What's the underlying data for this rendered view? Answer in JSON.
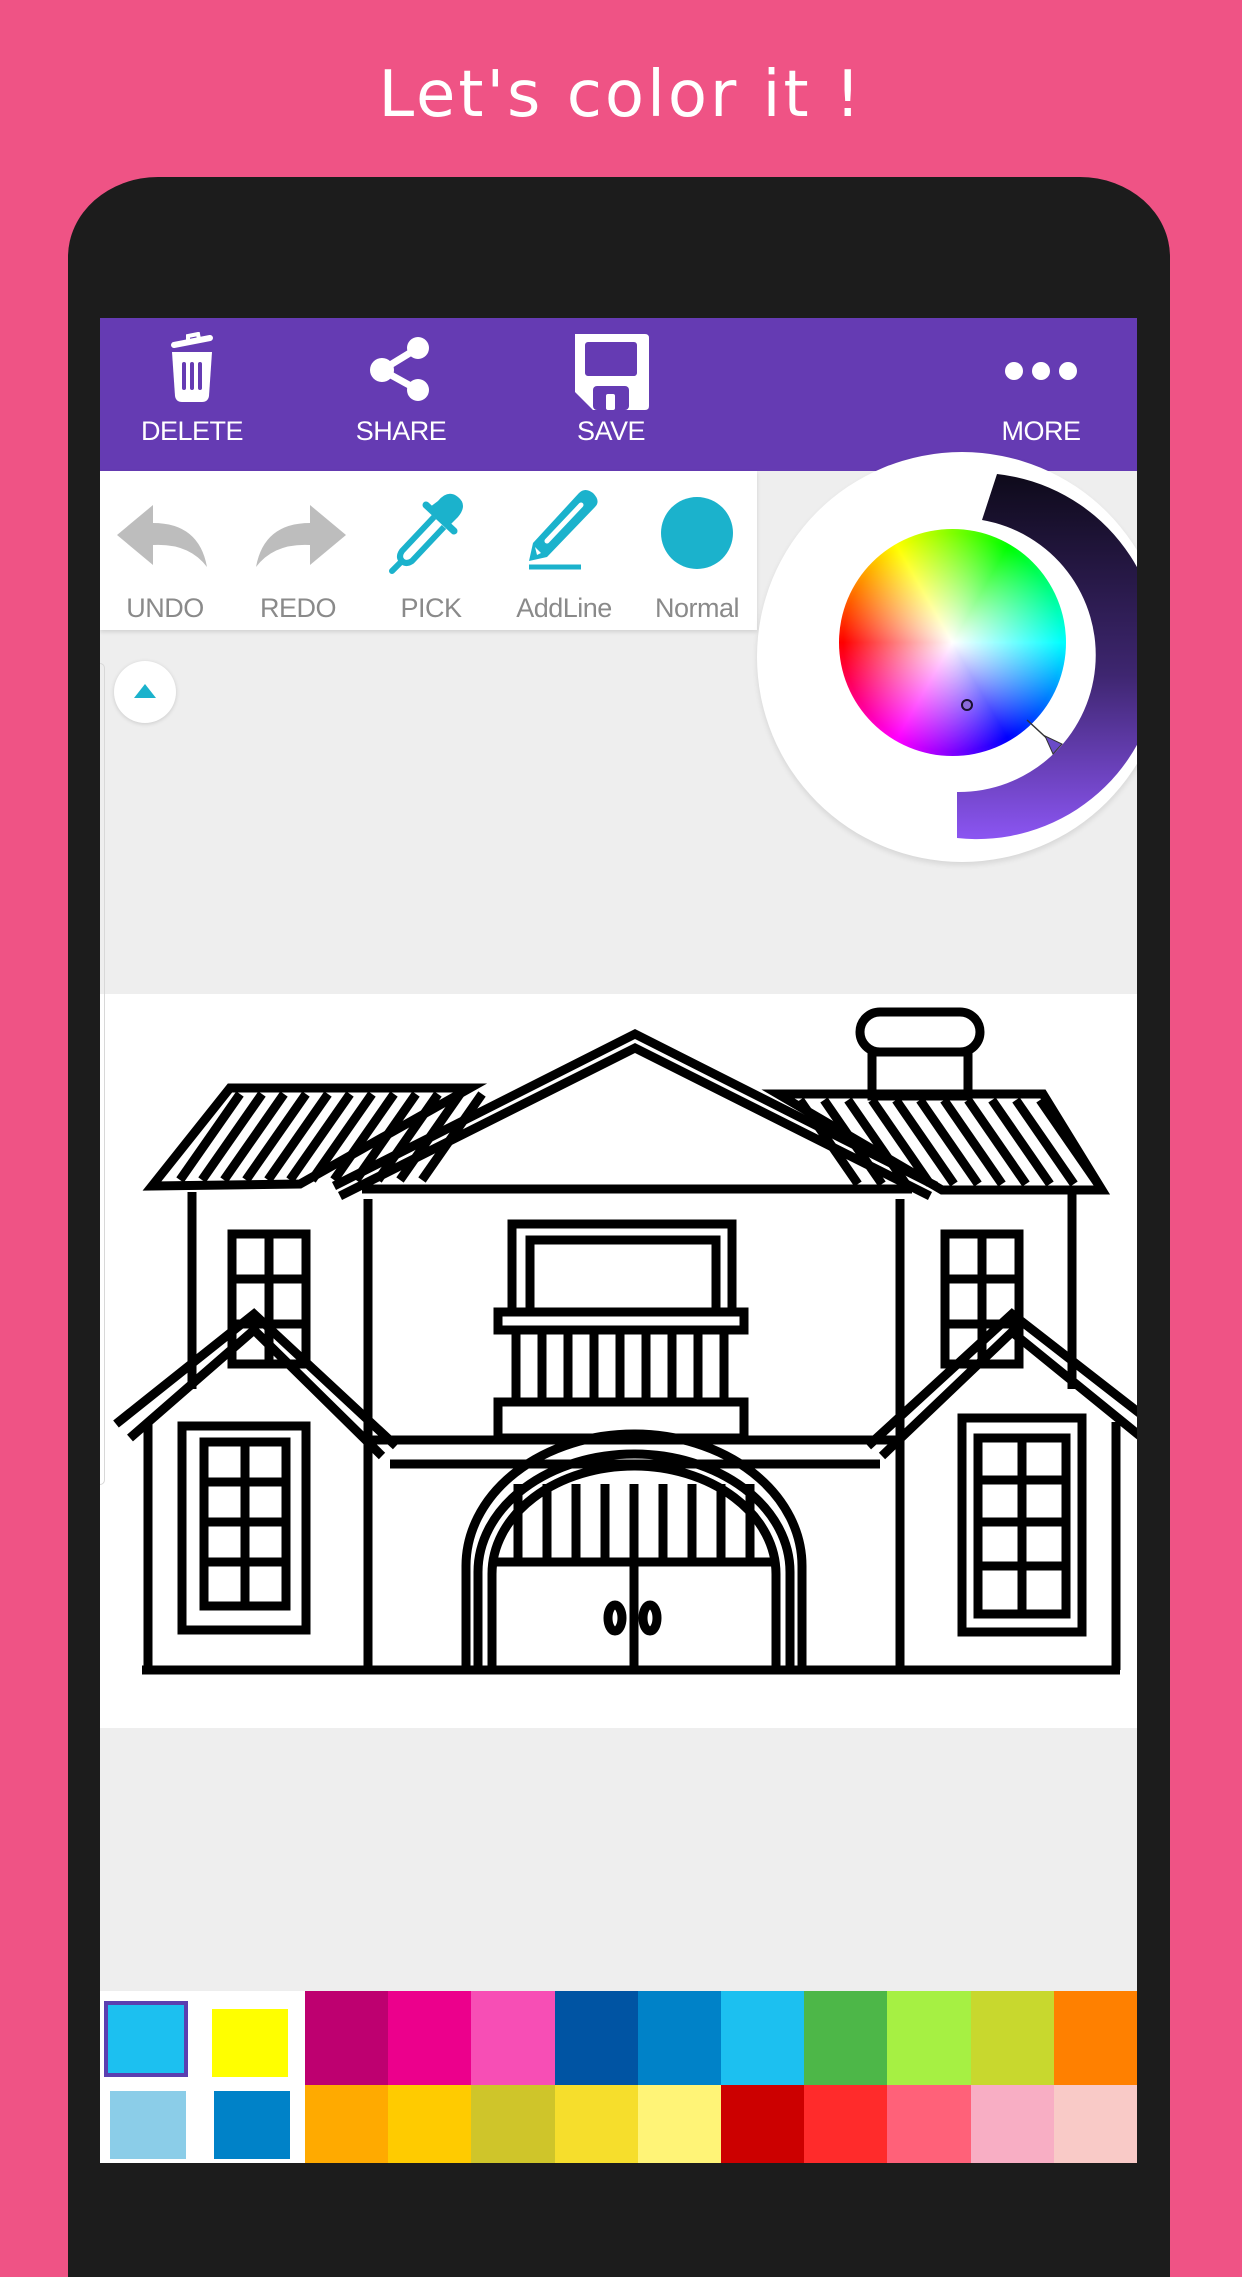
{
  "banner": {
    "title": "Let's color it !"
  },
  "colors": {
    "background": "#EF5385",
    "toolbar": "#653BB3",
    "accent": "#1BB2CC",
    "tool_inactive": "#BDBDBD",
    "canvas_bg": "#EEEEEE"
  },
  "toolbar": {
    "items": [
      {
        "id": "delete",
        "label": "DELETE",
        "icon": "trash-icon"
      },
      {
        "id": "share",
        "label": "SHARE",
        "icon": "share-icon"
      },
      {
        "id": "save",
        "label": "SAVE",
        "icon": "floppy-disk-icon"
      },
      {
        "id": "more",
        "label": "MORE",
        "icon": "more-dots-icon"
      }
    ]
  },
  "tools": {
    "items": [
      {
        "id": "undo",
        "label": "UNDO",
        "icon": "undo-arrow-icon",
        "enabled": false
      },
      {
        "id": "redo",
        "label": "REDO",
        "icon": "redo-arrow-icon",
        "enabled": false
      },
      {
        "id": "pick",
        "label": "PICK",
        "icon": "eyedropper-icon",
        "enabled": true
      },
      {
        "id": "addline",
        "label": "AddLine",
        "icon": "pencil-line-icon",
        "enabled": true
      },
      {
        "id": "normal",
        "label": "Normal",
        "icon": "brush-dot-icon",
        "enabled": true
      }
    ]
  },
  "color_picker": {
    "selected_color": "#653BB3",
    "brightness_ring": {
      "from": "#0E0A1A",
      "to": "#8B55F2"
    }
  },
  "drawing": {
    "subject": "house outline coloring page"
  },
  "palette": {
    "recent": [
      {
        "color": "#1CC0F0",
        "selected": true
      },
      {
        "color": "#FFFF00",
        "selected": false
      },
      {
        "color": "#8BCDE8",
        "selected": false
      },
      {
        "color": "#0082C8",
        "selected": false
      }
    ],
    "row1": [
      "#BE0070",
      "#EC008C",
      "#F74EB5",
      "#0054A3",
      "#0082C8",
      "#1CC0F0",
      "#4DB748",
      "#A6F043",
      "#C8D82E",
      "#FF8000"
    ],
    "row2": [
      "#FFAA00",
      "#FFCB00",
      "#CFC52A",
      "#F6DE2C",
      "#FFF477",
      "#CC0000",
      "#FF2B2B",
      "#FF6179",
      "#F8AEC4",
      "#F9CAC7"
    ]
  }
}
